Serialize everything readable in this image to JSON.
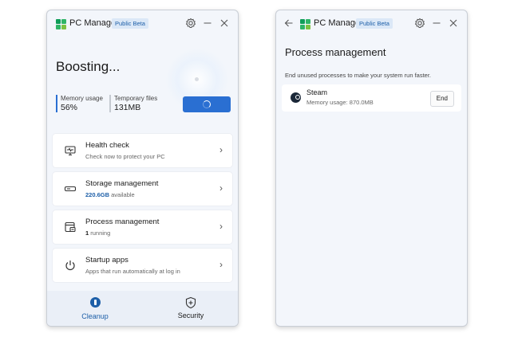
{
  "colors": {
    "accent": "#2a6fd2",
    "nav_active": "#1d5fa8",
    "window_bg": "#f3f6fb",
    "card_bg": "#ffffff"
  },
  "left_window": {
    "app_title": "PC Manager",
    "badge": "Public Beta",
    "icons": {
      "settings": "gear-icon",
      "minimize": "minimize-icon",
      "close": "close-icon"
    },
    "status_title": "Boosting...",
    "memory": {
      "label": "Memory usage",
      "value": "56%"
    },
    "temp_files": {
      "label": "Temporary files",
      "value": "131MB"
    },
    "boost_button": {
      "state": "loading",
      "icon": "spinner-icon"
    },
    "cards": [
      {
        "title": "Health check",
        "subtitle": "Check now to protect your PC",
        "icon": "monitor-heart-icon"
      },
      {
        "title": "Storage management",
        "subtitle_highlight": "220.6GB",
        "subtitle_rest": " available",
        "icon": "storage-drive-icon"
      },
      {
        "title": "Process management",
        "subtitle_highlight": "1",
        "subtitle_rest": " running",
        "icon": "process-window-icon"
      },
      {
        "title": "Startup apps",
        "subtitle": "Apps that run automatically at log in",
        "icon": "power-icon"
      }
    ],
    "nav": [
      {
        "label": "Cleanup",
        "icon": "cleanup-icon",
        "active": true
      },
      {
        "label": "Security",
        "icon": "shield-plus-icon",
        "active": false
      }
    ]
  },
  "right_window": {
    "app_title": "PC Manager",
    "badge": "Public Beta",
    "icons": {
      "back": "back-arrow-icon",
      "settings": "gear-icon",
      "minimize": "minimize-icon",
      "close": "close-icon"
    },
    "page_title": "Process management",
    "description": "End unused processes to make your system run faster.",
    "processes": [
      {
        "name": "Steam",
        "memory": "Memory usage: 870.0MB",
        "icon": "steam-icon",
        "action": "End"
      }
    ]
  }
}
